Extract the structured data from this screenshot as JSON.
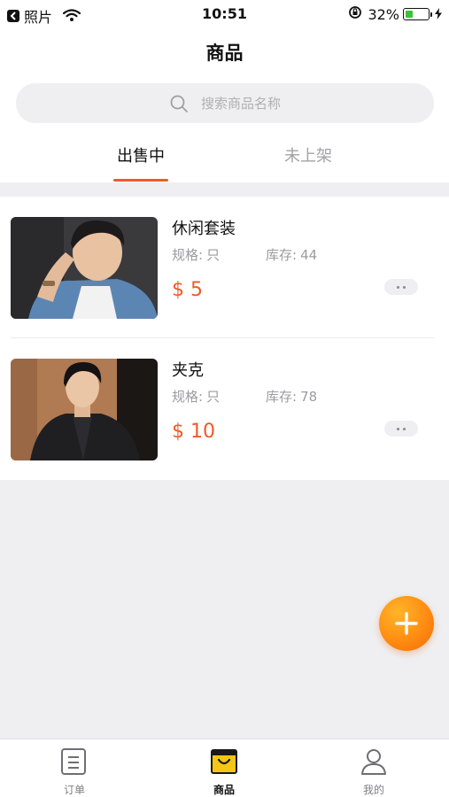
{
  "status_bar": {
    "app_name": "照片",
    "time": "10:51",
    "battery": "32%",
    "battery_level": 0.32,
    "battery_color": "#3cc13b"
  },
  "header": {
    "title": "商品"
  },
  "search": {
    "placeholder": "搜索商品名称",
    "icon": "search-icon"
  },
  "tabs": [
    {
      "label": "出售中",
      "active": true
    },
    {
      "label": "未上架",
      "active": false
    }
  ],
  "products": [
    {
      "name": "休闲套装",
      "spec_label": "规格:",
      "spec_value": "只",
      "stock_label": "库存:",
      "stock_value": "44",
      "price": "$ 5"
    },
    {
      "name": "夹克",
      "spec_label": "规格:",
      "spec_value": "只",
      "stock_label": "库存:",
      "stock_value": "78",
      "price": "$ 10"
    }
  ],
  "fab": {
    "icon": "plus-icon"
  },
  "tab_bar": {
    "items": [
      {
        "label": "订单",
        "icon": "orders-icon",
        "active": false
      },
      {
        "label": "商品",
        "icon": "shop-bag-icon",
        "active": true
      },
      {
        "label": "我的",
        "icon": "person-icon",
        "active": false
      }
    ]
  },
  "colors": {
    "accent": "#f05a28",
    "fab": "#ff8c12",
    "background": "#efeff2",
    "active_tab_icon": "#f5c518"
  }
}
